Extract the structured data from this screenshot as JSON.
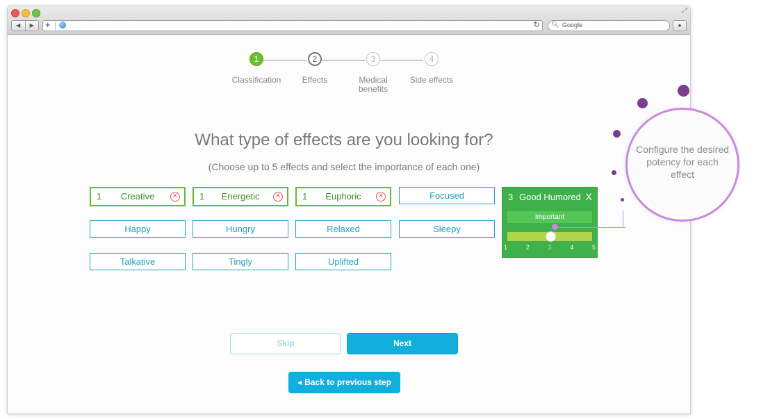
{
  "browser": {
    "search_placeholder": "Google"
  },
  "steps": [
    {
      "number": "1",
      "label": "Classification",
      "state": "active"
    },
    {
      "number": "2",
      "label": "Effects",
      "state": "current"
    },
    {
      "number": "3",
      "label": "Medical benefits",
      "state": "future"
    },
    {
      "number": "4",
      "label": "Side effects",
      "state": "future"
    }
  ],
  "main": {
    "title": "What type of effects are you looking for?",
    "subtitle": "(Choose up to 5 effects and select the importance of each one)"
  },
  "effects": {
    "creative": {
      "label": "Creative",
      "level": "1",
      "selected": true
    },
    "energetic": {
      "label": "Energetic",
      "level": "1",
      "selected": true
    },
    "euphoric": {
      "label": "Euphoric",
      "level": "1",
      "selected": true
    },
    "focused": {
      "label": "Focused",
      "selected": false
    },
    "happy": {
      "label": "Happy",
      "selected": false
    },
    "hungry": {
      "label": "Hungry",
      "selected": false
    },
    "relaxed": {
      "label": "Relaxed",
      "selected": false
    },
    "sleepy": {
      "label": "Sleepy",
      "selected": false
    },
    "talkative": {
      "label": "Talkative",
      "selected": false
    },
    "tingly": {
      "label": "Tingly",
      "selected": false
    },
    "uplifted": {
      "label": "Uplifted",
      "selected": false
    }
  },
  "potency_panel": {
    "level": "3",
    "effect": "Good Humored",
    "close": "X",
    "importance": "Important",
    "scale": [
      "1",
      "2",
      "3",
      "4",
      "5"
    ],
    "selected_value": 3
  },
  "buttons": {
    "skip": "Skip",
    "next": "Next",
    "back": "Back to previous step"
  },
  "callout": {
    "text": "Configure the desired potency for each effect"
  },
  "colors": {
    "accent": "#12aedc",
    "selected_green": "#67b93a",
    "panel_green": "#3fb04a",
    "callout_purple": "#c889e0"
  }
}
